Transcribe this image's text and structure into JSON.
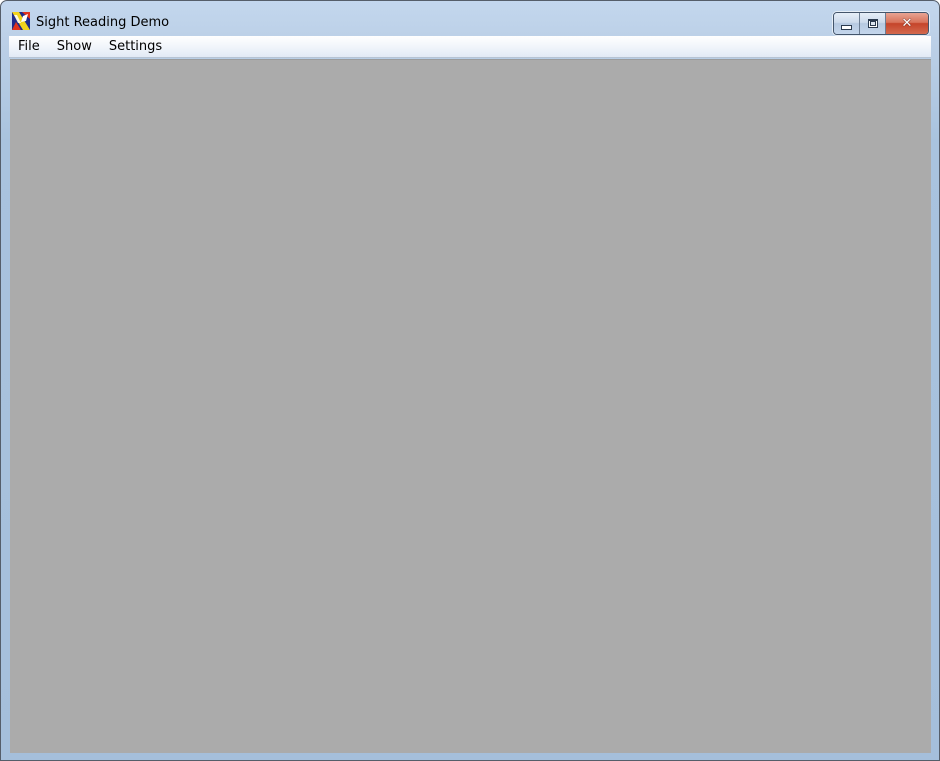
{
  "window": {
    "title": "Sight Reading Demo",
    "icon": "app-logo-icon"
  },
  "caption": {
    "minimize_icon": "minimize-icon",
    "maximize_icon": "maximize-icon",
    "close_icon": "close-icon",
    "close_glyph": "✕"
  },
  "menu": {
    "items": [
      {
        "label": "File"
      },
      {
        "label": "Show"
      },
      {
        "label": "Settings"
      }
    ]
  },
  "colors": {
    "client_background": "#ababab",
    "close_button": "#c5442a",
    "frame": "#a9c3de"
  }
}
